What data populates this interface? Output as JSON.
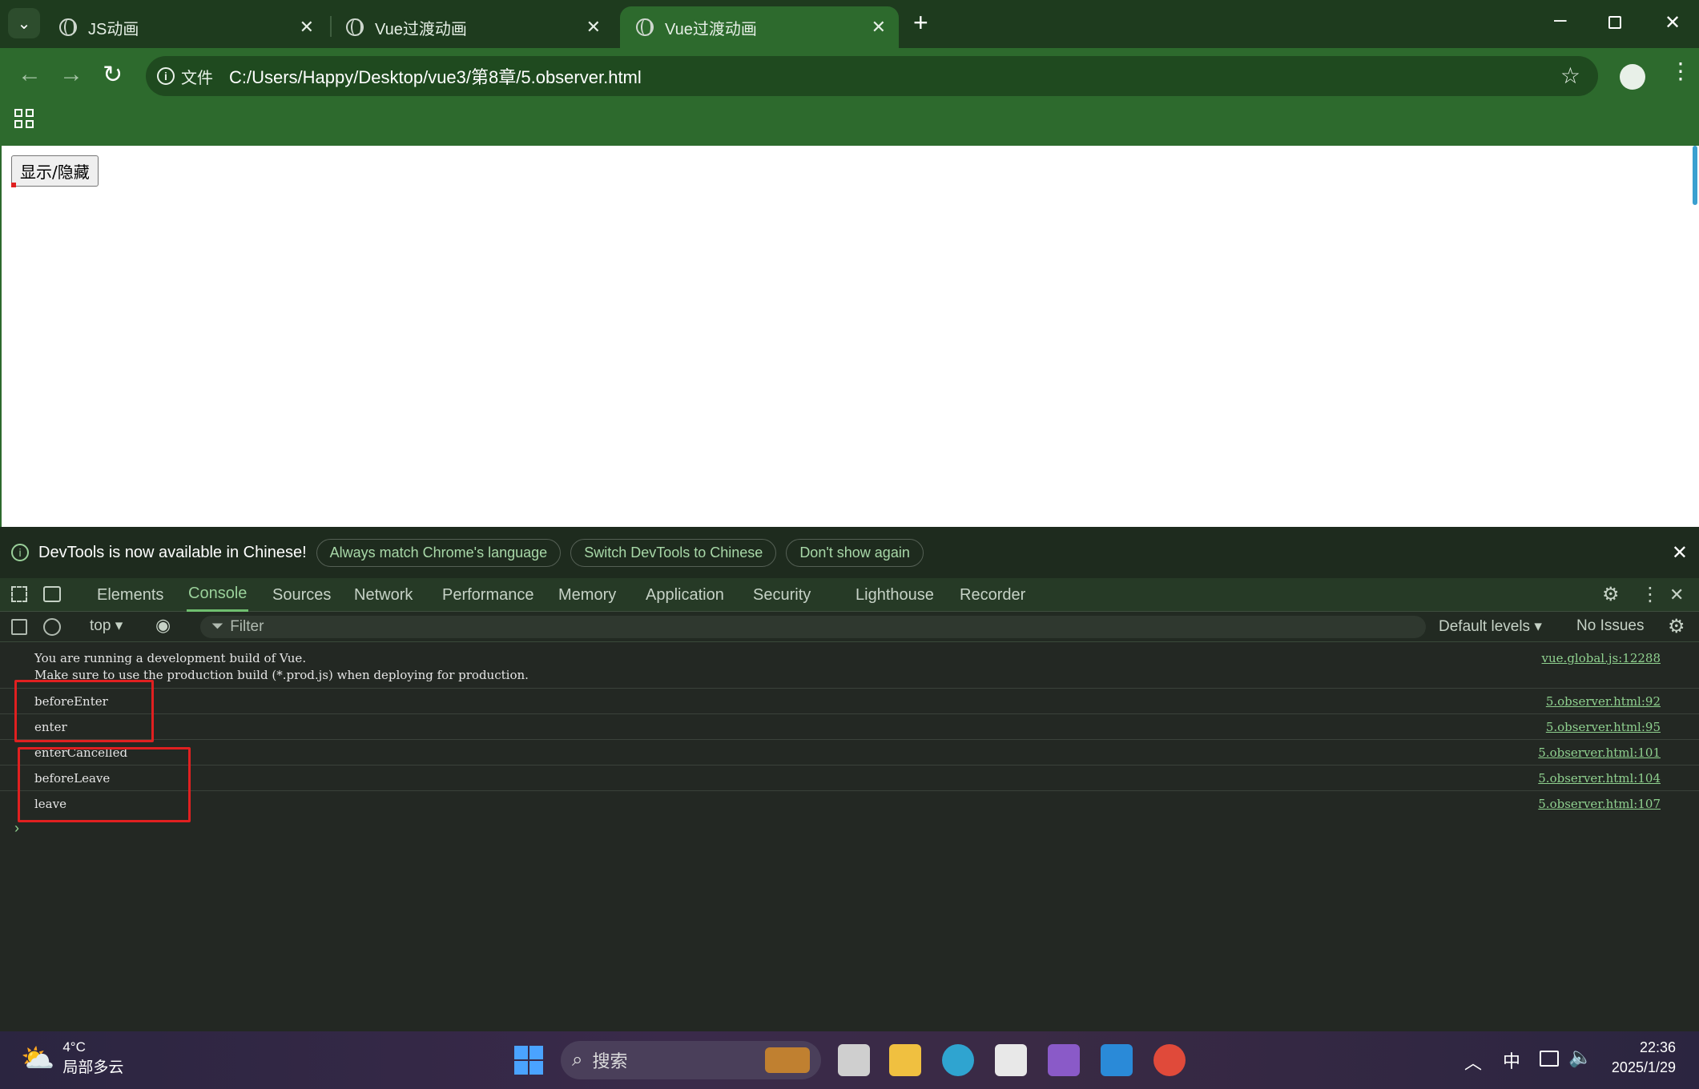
{
  "browser": {
    "tabs": [
      {
        "title": "JS动画",
        "active": false
      },
      {
        "title": "Vue过渡动画",
        "active": false
      },
      {
        "title": "Vue过渡动画",
        "active": true
      }
    ],
    "address_prefix": "文件",
    "url": "C:/Users/Happy/Desktop/vue3/第8章/5.observer.html"
  },
  "page": {
    "toggle_button": "显示/隐藏"
  },
  "infobar": {
    "message": "DevTools is now available in Chinese!",
    "buttons": [
      "Always match Chrome's language",
      "Switch DevTools to Chinese",
      "Don't show again"
    ]
  },
  "devtools": {
    "tabs": [
      "Elements",
      "Console",
      "Sources",
      "Network",
      "Performance",
      "Memory",
      "Application",
      "Security",
      "Lighthouse",
      "Recorder"
    ],
    "active_tab": "Console",
    "context": "top",
    "filter_placeholder": "Filter",
    "levels": "Default levels",
    "issues": "No Issues"
  },
  "console": {
    "logs": [
      {
        "message": "You are running a development build of Vue.",
        "message2": "Make sure to use the production build (*.prod.js) when deploying for production.",
        "source": "vue.global.js:12288"
      },
      {
        "message": "beforeEnter",
        "source": "5.observer.html:92"
      },
      {
        "message": "enter",
        "source": "5.observer.html:95"
      },
      {
        "message": "enterCancelled",
        "source": "5.observer.html:101"
      },
      {
        "message": "beforeLeave",
        "source": "5.observer.html:104"
      },
      {
        "message": "leave",
        "source": "5.observer.html:107"
      }
    ],
    "prompt": "›"
  },
  "taskbar": {
    "weather_temp": "4°C",
    "weather_desc": "局部多云",
    "search_placeholder": "搜索",
    "ime": "中",
    "time": "22:36",
    "date": "2025/1/29"
  },
  "colors": {
    "tab_bar": "#1e3b1e",
    "toolbar": "#2d6a2d",
    "highlight_box": "#e02020",
    "link": "#8fd18f"
  }
}
